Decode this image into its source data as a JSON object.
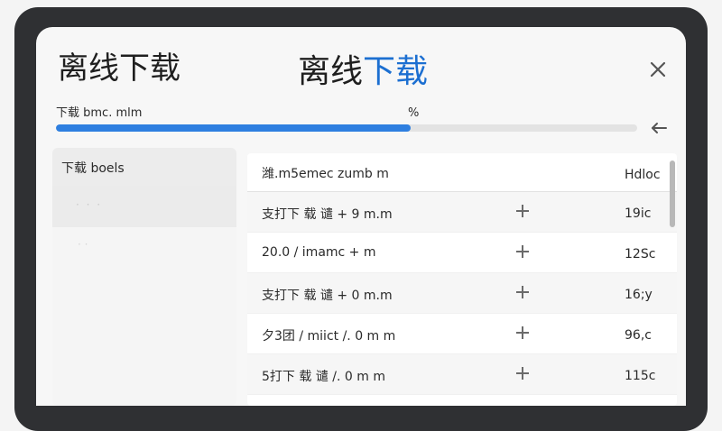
{
  "header": {
    "left_title": "离线下载",
    "center_title_part1": "离线",
    "center_title_part2": "下载"
  },
  "progress": {
    "label": "下载 bmc. mlm",
    "percent_text": "%",
    "fraction": 0.61
  },
  "sidebar": {
    "heading": "下载 boels",
    "selected_item": "· · ·",
    "faint_item": "· ·"
  },
  "table": {
    "headers": [
      "潍.m5emec   zumb m",
      "Hdloc"
    ],
    "rows": [
      {
        "name": "支打下 载 谴 + 9 m.m",
        "size": "19ic"
      },
      {
        "name": "20.0 / imamc + m",
        "size": "12Sc"
      },
      {
        "name": "支打下 载 谴 + 0 m.m",
        "size": "16;y"
      },
      {
        "name": "夕3团 / miict /. 0 m m",
        "size": "96,c"
      },
      {
        "name": "5打下 载 谴 /. 0 m m",
        "size": "115c"
      }
    ]
  },
  "colors": {
    "accent": "#1c6fd1",
    "progress": "#2e7fe0"
  },
  "icons": {
    "close": "close-icon",
    "back": "arrow-left-icon",
    "add": "plus-icon"
  }
}
